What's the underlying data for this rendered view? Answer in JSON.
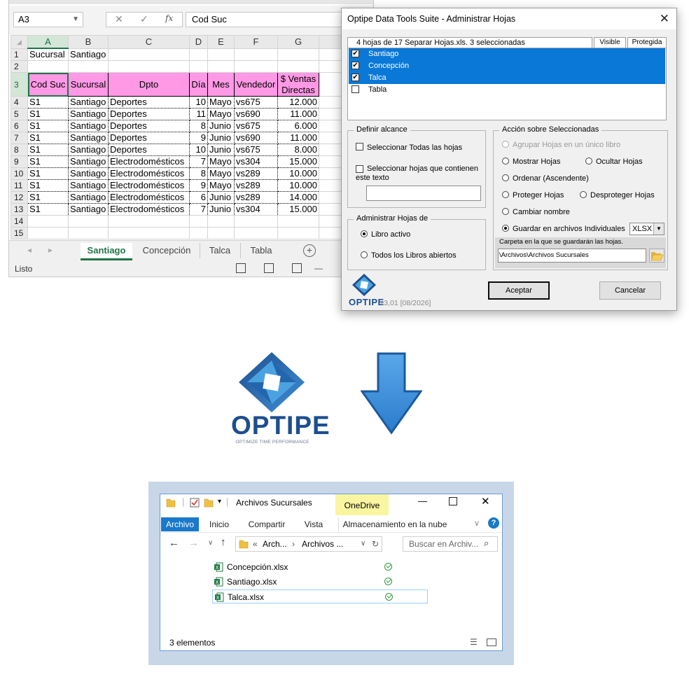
{
  "excel": {
    "name_box": "A3",
    "formula_bar": "Cod Suc",
    "fx_label": "fx",
    "columns": [
      "",
      "A",
      "B",
      "C",
      "D",
      "E",
      "F",
      "G"
    ],
    "row1": {
      "num": "1",
      "a": "Sucursal",
      "b": "Santiago"
    },
    "row2": {
      "num": "2"
    },
    "header_row": {
      "num": "3",
      "cells": [
        "Cod Suc",
        "Sucursal",
        "Dpto",
        "Día",
        "Mes",
        "Vendedor",
        "$ Ventas Directas"
      ]
    },
    "rows": [
      {
        "num": "4",
        "cells": [
          "S1",
          "Santiago",
          "Deportes",
          "10",
          "Mayo",
          "vs675",
          "12.000"
        ]
      },
      {
        "num": "5",
        "cells": [
          "S1",
          "Santiago",
          "Deportes",
          "11",
          "Mayo",
          "vs690",
          "11.000"
        ]
      },
      {
        "num": "6",
        "cells": [
          "S1",
          "Santiago",
          "Deportes",
          "8",
          "Junio",
          "vs675",
          "6.000"
        ]
      },
      {
        "num": "7",
        "cells": [
          "S1",
          "Santiago",
          "Deportes",
          "9",
          "Junio",
          "vs690",
          "11.000"
        ]
      },
      {
        "num": "8",
        "cells": [
          "S1",
          "Santiago",
          "Deportes",
          "10",
          "Junio",
          "vs675",
          "8.000"
        ]
      },
      {
        "num": "9",
        "cells": [
          "S1",
          "Santiago",
          "Electrodomésticos",
          "7",
          "Mayo",
          "vs304",
          "15.000"
        ]
      },
      {
        "num": "10",
        "cells": [
          "S1",
          "Santiago",
          "Electrodomésticos",
          "8",
          "Mayo",
          "vs289",
          "10.000"
        ]
      },
      {
        "num": "11",
        "cells": [
          "S1",
          "Santiago",
          "Electrodomésticos",
          "9",
          "Mayo",
          "vs289",
          "10.000"
        ]
      },
      {
        "num": "12",
        "cells": [
          "S1",
          "Santiago",
          "Electrodomésticos",
          "6",
          "Junio",
          "vs289",
          "14.000"
        ]
      },
      {
        "num": "13",
        "cells": [
          "S1",
          "Santiago",
          "Electrodomésticos",
          "7",
          "Junio",
          "vs304",
          "15.000"
        ]
      }
    ],
    "empty_rows": [
      "14",
      "15"
    ],
    "sheet_tabs": [
      "Santiago",
      "Concepción",
      "Talca",
      "Tabla"
    ],
    "status": "Listo"
  },
  "dialog": {
    "title": "Optipe Data Tools Suite - Administrar Hojas",
    "list_header": "4 hojas de 17 Separar Hojas.xls.  3 seleccionadas",
    "col_visible": "Visible",
    "col_protegida": "Protegida",
    "sheets": [
      {
        "name": "Santiago",
        "checked": "✔"
      },
      {
        "name": "Concepción",
        "checked": "✔"
      },
      {
        "name": "Talca",
        "checked": "✔"
      },
      {
        "name": "Tabla",
        "checked": ""
      }
    ],
    "alcance": {
      "title": "Definir alcance",
      "all": "Seleccionar Todas las hojas",
      "contains": "Seleccionar hojas que contienen este texto"
    },
    "admin": {
      "title": "Administrar Hojas de",
      "libro": "Libro activo",
      "todos": "Todos los Libros abiertos"
    },
    "accion": {
      "title": "Acción sobre Seleccionadas",
      "agrupar": "Agrupar Hojas en un único libro",
      "mostrar": "Mostrar Hojas",
      "ocultar": "Ocultar Hojas",
      "ordenar": "Ordenar (Ascendente)",
      "proteger": "Proteger Hojas",
      "desproteger": "Desproteger Hojas",
      "cambiar": "Cambiar nombre",
      "guardar": "Guardar en archivos Individuales",
      "format": "XLSX",
      "folder_label": "Carpeta en la que se guardarán las hojas.",
      "folder_path": "\\Archivos\\Archivos Sucursales"
    },
    "aceptar": "Aceptar",
    "cancelar": "Cancelar",
    "brand": "OPTIPE",
    "version": "v3,01 [08/2026]"
  },
  "logo": {
    "brand": "OPTIPE",
    "tagline": "OPTIMIZE TIME PERFORMANCE",
    "colors": {
      "blue_dark": "#1d4f8f",
      "blue_light": "#4aa3e0",
      "arrow": "#2e8ad8",
      "arrow_outline": "#1c5a9c"
    }
  },
  "explorer": {
    "title": "Archivos Sucursales",
    "onedrive": "OneDrive",
    "tabs": [
      "Archivo",
      "Inicio",
      "Compartir",
      "Vista",
      "Almacenamiento en la nube"
    ],
    "address": [
      "Arch...",
      "Archivos ..."
    ],
    "search_placeholder": "Buscar en Archiv...",
    "files": [
      "Concepción.xlsx",
      "Santiago.xlsx",
      "Talca.xlsx"
    ],
    "status": "3 elementos"
  }
}
